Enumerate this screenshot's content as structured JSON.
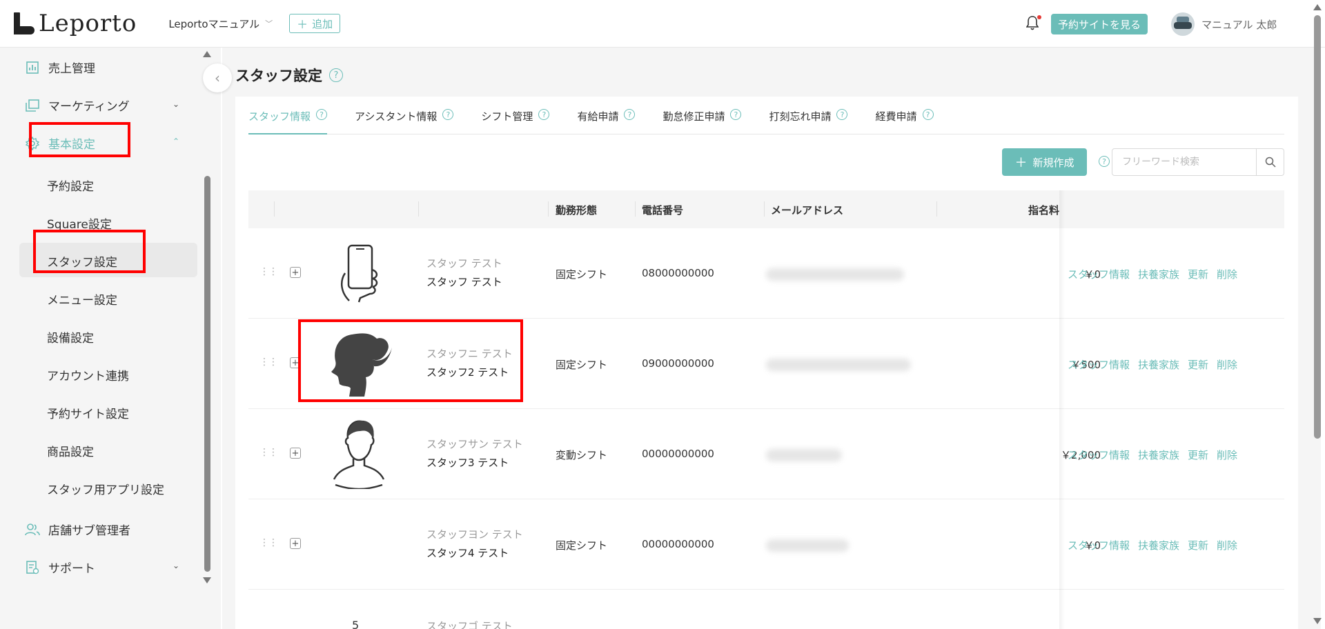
{
  "app": {
    "logo_text": "Leporto",
    "shop_selector": "Leportoマニュアル",
    "add_button": "追加",
    "view_site_button": "予約サイトを見る",
    "user_name": "マニュアル 太郎",
    "accent_color": "#6bbdb8"
  },
  "sidebar": {
    "items": [
      {
        "label": "売上管理",
        "icon": "sales-chart-icon"
      },
      {
        "label": "マーケティング",
        "icon": "marketing-icon",
        "expanded": false
      },
      {
        "label": "基本設定",
        "icon": "gear-icon",
        "expanded": true
      },
      {
        "label": "店舗サブ管理者",
        "icon": "users-icon"
      },
      {
        "label": "サポート",
        "icon": "support-icon",
        "expanded": false
      }
    ],
    "sub_items": [
      "予約設定",
      "Square設定",
      "スタッフ設定",
      "メニュー設定",
      "設備設定",
      "アカウント連携",
      "予約サイト設定",
      "商品設定",
      "スタッフ用アプリ設定"
    ],
    "active_sub_item": "スタッフ設定"
  },
  "page": {
    "title": "スタッフ設定",
    "tabs": [
      {
        "label": "スタッフ情報",
        "active": true
      },
      {
        "label": "アシスタント情報",
        "active": false
      },
      {
        "label": "シフト管理",
        "active": false
      },
      {
        "label": "有給申請",
        "active": false
      },
      {
        "label": "勤怠修正申請",
        "active": false
      },
      {
        "label": "打刻忘れ申請",
        "active": false
      },
      {
        "label": "経費申請",
        "active": false
      }
    ],
    "new_button": "新規作成",
    "search_placeholder": "フリーワード検索"
  },
  "table": {
    "headers": {
      "employment": "勤務形態",
      "phone": "電話番号",
      "email": "メールアドレス",
      "fee": "指名料"
    },
    "rows": [
      {
        "kana": "スタッフ テスト",
        "name": "スタッフ テスト",
        "employment": "固定シフト",
        "phone": "08000000000",
        "fee": "￥0",
        "photo": "smartphone-hand-icon"
      },
      {
        "kana": "スタッフニ テスト",
        "name": "スタッフ2 テスト",
        "employment": "固定シフト",
        "phone": "09000000000",
        "fee": "￥500",
        "photo": "woman-ponytail-icon"
      },
      {
        "kana": "スタッフサン テスト",
        "name": "スタッフ3 テスト",
        "employment": "変動シフト",
        "phone": "00000000000",
        "fee": "￥2,000",
        "photo": "man-silhouette-icon"
      },
      {
        "kana": "スタッフヨン テスト",
        "name": "スタッフ4 テスト",
        "employment": "固定シフト",
        "phone": "00000000000",
        "fee": "￥0",
        "photo": ""
      },
      {
        "kana": "スタッフゴ テスト",
        "name": "",
        "employment": "",
        "phone": "",
        "fee": "",
        "photo": ""
      }
    ],
    "actions": [
      "スタッフ情報",
      "扶養家族",
      "更新",
      "削除"
    ]
  }
}
